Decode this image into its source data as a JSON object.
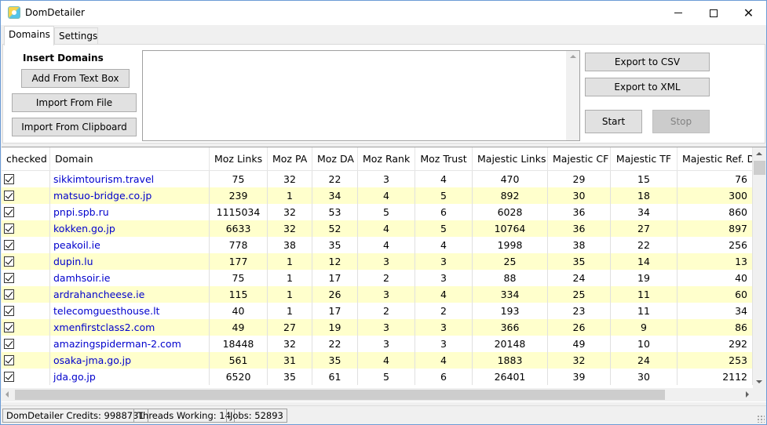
{
  "window": {
    "title": "DomDetailer",
    "icon": "app-logo-icon"
  },
  "tabs": [
    {
      "label": "Domains",
      "active": true
    },
    {
      "label": "Settings",
      "active": false
    }
  ],
  "panel": {
    "insert_label": "Insert Domains",
    "buttons": {
      "add_text": "Add From Text Box",
      "import_file": "Import From File",
      "import_clipboard": "Import From Clipboard",
      "export_csv": "Export to CSV",
      "export_xml": "Export to XML",
      "start": "Start",
      "stop": "Stop"
    },
    "textbox_value": ""
  },
  "grid": {
    "columns": [
      "checked",
      "Domain",
      "Moz Links",
      "Moz PA",
      "Moz DA",
      "Moz Rank",
      "Moz Trust",
      "Majestic Links",
      "Majestic CF",
      "Majestic TF",
      "Majestic Ref. D"
    ],
    "rows": [
      [
        "sikkimtourism.travel",
        "75",
        "32",
        "22",
        "3",
        "4",
        "470",
        "29",
        "15",
        "76"
      ],
      [
        "matsuo-bridge.co.jp",
        "239",
        "1",
        "34",
        "4",
        "5",
        "892",
        "30",
        "18",
        "300"
      ],
      [
        "pnpi.spb.ru",
        "1115034",
        "32",
        "53",
        "5",
        "6",
        "6028",
        "36",
        "34",
        "860"
      ],
      [
        "kokken.go.jp",
        "6633",
        "32",
        "52",
        "4",
        "5",
        "10764",
        "36",
        "27",
        "897"
      ],
      [
        "peakoil.ie",
        "778",
        "38",
        "35",
        "4",
        "4",
        "1998",
        "38",
        "22",
        "256"
      ],
      [
        "dupin.lu",
        "177",
        "1",
        "12",
        "3",
        "3",
        "25",
        "35",
        "14",
        "13"
      ],
      [
        "damhsoir.ie",
        "75",
        "1",
        "17",
        "2",
        "3",
        "88",
        "24",
        "19",
        "40"
      ],
      [
        "ardrahancheese.ie",
        "115",
        "1",
        "26",
        "3",
        "4",
        "334",
        "25",
        "11",
        "60"
      ],
      [
        "telecomguesthouse.lt",
        "40",
        "1",
        "17",
        "2",
        "2",
        "193",
        "23",
        "11",
        "34"
      ],
      [
        "xmenfirstclass2.com",
        "49",
        "27",
        "19",
        "3",
        "3",
        "366",
        "26",
        "9",
        "86"
      ],
      [
        "amazingspiderman-2.com",
        "18448",
        "32",
        "22",
        "3",
        "3",
        "20148",
        "49",
        "10",
        "292"
      ],
      [
        "osaka-jma.go.jp",
        "561",
        "31",
        "35",
        "4",
        "4",
        "1883",
        "32",
        "24",
        "253"
      ],
      [
        "jda.go.jp",
        "6520",
        "35",
        "61",
        "5",
        "6",
        "26401",
        "39",
        "30",
        "2112"
      ]
    ]
  },
  "status": {
    "credits": "DomDetailer Credits: 9988731",
    "threads": "Threads Working: 14",
    "jobs": "Jobs: 52893"
  },
  "colors": {
    "row_alt": "#ffffcc",
    "domain_link": "#0000cc",
    "window_border": "#6b9bd6"
  }
}
